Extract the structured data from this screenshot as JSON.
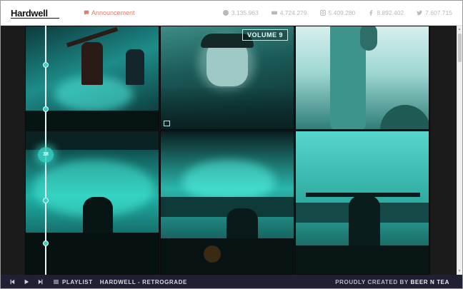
{
  "header": {
    "logo_text": "Hardwell",
    "announcement_label": "Announcement",
    "stats": [
      {
        "icon": "spotify-icon",
        "value": "3.135.963"
      },
      {
        "icon": "youtube-icon",
        "value": "4.724.279"
      },
      {
        "icon": "instagram-icon",
        "value": "5.409.280"
      },
      {
        "icon": "facebook-icon",
        "value": "8.892.402"
      },
      {
        "icon": "twitter-icon",
        "value": "7.607.715"
      }
    ]
  },
  "grid": {
    "tiles": [
      {
        "name": "dj-celebration-photo"
      },
      {
        "name": "volume-9-cover",
        "badge": "VOLUME 9"
      },
      {
        "name": "portrait-photo"
      },
      {
        "name": "stage-crowd-photo"
      },
      {
        "name": "dj-booth-photo"
      },
      {
        "name": "arms-raised-photo"
      }
    ]
  },
  "timeline": {
    "active_marker": "38"
  },
  "player": {
    "playlist_label": "PLAYLIST",
    "track_title": "HARDWELL - RETROGRADE",
    "credit_prefix": "PROUDLY CREATED BY",
    "credit_name": "BEER N TEA"
  },
  "colors": {
    "accent_teal": "#38d3c6",
    "announcement": "#e07a6b",
    "player_bg": "#1f2033"
  }
}
